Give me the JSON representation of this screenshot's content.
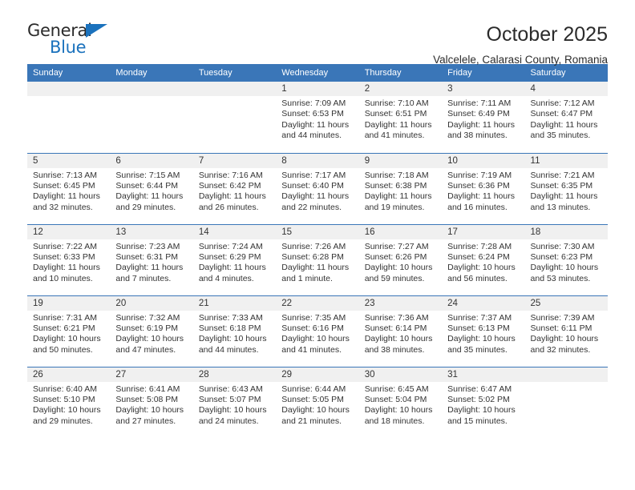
{
  "brand": {
    "name_top": "General",
    "name_bottom": "Blue"
  },
  "header": {
    "title": "October 2025",
    "subtitle": "Valcelele, Calarasi County, Romania"
  },
  "calendar": {
    "weekday_headers": [
      "Sunday",
      "Monday",
      "Tuesday",
      "Wednesday",
      "Thursday",
      "Friday",
      "Saturday"
    ],
    "accent_color": "#3a76b8",
    "daynum_band_color": "#f0f0f0",
    "text_color": "#333333",
    "weeks": [
      [
        {
          "day": "",
          "sunrise": "",
          "sunset": "",
          "daylight": ""
        },
        {
          "day": "",
          "sunrise": "",
          "sunset": "",
          "daylight": ""
        },
        {
          "day": "",
          "sunrise": "",
          "sunset": "",
          "daylight": ""
        },
        {
          "day": "1",
          "sunrise": "Sunrise: 7:09 AM",
          "sunset": "Sunset: 6:53 PM",
          "daylight": "Daylight: 11 hours and 44 minutes."
        },
        {
          "day": "2",
          "sunrise": "Sunrise: 7:10 AM",
          "sunset": "Sunset: 6:51 PM",
          "daylight": "Daylight: 11 hours and 41 minutes."
        },
        {
          "day": "3",
          "sunrise": "Sunrise: 7:11 AM",
          "sunset": "Sunset: 6:49 PM",
          "daylight": "Daylight: 11 hours and 38 minutes."
        },
        {
          "day": "4",
          "sunrise": "Sunrise: 7:12 AM",
          "sunset": "Sunset: 6:47 PM",
          "daylight": "Daylight: 11 hours and 35 minutes."
        }
      ],
      [
        {
          "day": "5",
          "sunrise": "Sunrise: 7:13 AM",
          "sunset": "Sunset: 6:45 PM",
          "daylight": "Daylight: 11 hours and 32 minutes."
        },
        {
          "day": "6",
          "sunrise": "Sunrise: 7:15 AM",
          "sunset": "Sunset: 6:44 PM",
          "daylight": "Daylight: 11 hours and 29 minutes."
        },
        {
          "day": "7",
          "sunrise": "Sunrise: 7:16 AM",
          "sunset": "Sunset: 6:42 PM",
          "daylight": "Daylight: 11 hours and 26 minutes."
        },
        {
          "day": "8",
          "sunrise": "Sunrise: 7:17 AM",
          "sunset": "Sunset: 6:40 PM",
          "daylight": "Daylight: 11 hours and 22 minutes."
        },
        {
          "day": "9",
          "sunrise": "Sunrise: 7:18 AM",
          "sunset": "Sunset: 6:38 PM",
          "daylight": "Daylight: 11 hours and 19 minutes."
        },
        {
          "day": "10",
          "sunrise": "Sunrise: 7:19 AM",
          "sunset": "Sunset: 6:36 PM",
          "daylight": "Daylight: 11 hours and 16 minutes."
        },
        {
          "day": "11",
          "sunrise": "Sunrise: 7:21 AM",
          "sunset": "Sunset: 6:35 PM",
          "daylight": "Daylight: 11 hours and 13 minutes."
        }
      ],
      [
        {
          "day": "12",
          "sunrise": "Sunrise: 7:22 AM",
          "sunset": "Sunset: 6:33 PM",
          "daylight": "Daylight: 11 hours and 10 minutes."
        },
        {
          "day": "13",
          "sunrise": "Sunrise: 7:23 AM",
          "sunset": "Sunset: 6:31 PM",
          "daylight": "Daylight: 11 hours and 7 minutes."
        },
        {
          "day": "14",
          "sunrise": "Sunrise: 7:24 AM",
          "sunset": "Sunset: 6:29 PM",
          "daylight": "Daylight: 11 hours and 4 minutes."
        },
        {
          "day": "15",
          "sunrise": "Sunrise: 7:26 AM",
          "sunset": "Sunset: 6:28 PM",
          "daylight": "Daylight: 11 hours and 1 minute."
        },
        {
          "day": "16",
          "sunrise": "Sunrise: 7:27 AM",
          "sunset": "Sunset: 6:26 PM",
          "daylight": "Daylight: 10 hours and 59 minutes."
        },
        {
          "day": "17",
          "sunrise": "Sunrise: 7:28 AM",
          "sunset": "Sunset: 6:24 PM",
          "daylight": "Daylight: 10 hours and 56 minutes."
        },
        {
          "day": "18",
          "sunrise": "Sunrise: 7:30 AM",
          "sunset": "Sunset: 6:23 PM",
          "daylight": "Daylight: 10 hours and 53 minutes."
        }
      ],
      [
        {
          "day": "19",
          "sunrise": "Sunrise: 7:31 AM",
          "sunset": "Sunset: 6:21 PM",
          "daylight": "Daylight: 10 hours and 50 minutes."
        },
        {
          "day": "20",
          "sunrise": "Sunrise: 7:32 AM",
          "sunset": "Sunset: 6:19 PM",
          "daylight": "Daylight: 10 hours and 47 minutes."
        },
        {
          "day": "21",
          "sunrise": "Sunrise: 7:33 AM",
          "sunset": "Sunset: 6:18 PM",
          "daylight": "Daylight: 10 hours and 44 minutes."
        },
        {
          "day": "22",
          "sunrise": "Sunrise: 7:35 AM",
          "sunset": "Sunset: 6:16 PM",
          "daylight": "Daylight: 10 hours and 41 minutes."
        },
        {
          "day": "23",
          "sunrise": "Sunrise: 7:36 AM",
          "sunset": "Sunset: 6:14 PM",
          "daylight": "Daylight: 10 hours and 38 minutes."
        },
        {
          "day": "24",
          "sunrise": "Sunrise: 7:37 AM",
          "sunset": "Sunset: 6:13 PM",
          "daylight": "Daylight: 10 hours and 35 minutes."
        },
        {
          "day": "25",
          "sunrise": "Sunrise: 7:39 AM",
          "sunset": "Sunset: 6:11 PM",
          "daylight": "Daylight: 10 hours and 32 minutes."
        }
      ],
      [
        {
          "day": "26",
          "sunrise": "Sunrise: 6:40 AM",
          "sunset": "Sunset: 5:10 PM",
          "daylight": "Daylight: 10 hours and 29 minutes."
        },
        {
          "day": "27",
          "sunrise": "Sunrise: 6:41 AM",
          "sunset": "Sunset: 5:08 PM",
          "daylight": "Daylight: 10 hours and 27 minutes."
        },
        {
          "day": "28",
          "sunrise": "Sunrise: 6:43 AM",
          "sunset": "Sunset: 5:07 PM",
          "daylight": "Daylight: 10 hours and 24 minutes."
        },
        {
          "day": "29",
          "sunrise": "Sunrise: 6:44 AM",
          "sunset": "Sunset: 5:05 PM",
          "daylight": "Daylight: 10 hours and 21 minutes."
        },
        {
          "day": "30",
          "sunrise": "Sunrise: 6:45 AM",
          "sunset": "Sunset: 5:04 PM",
          "daylight": "Daylight: 10 hours and 18 minutes."
        },
        {
          "day": "31",
          "sunrise": "Sunrise: 6:47 AM",
          "sunset": "Sunset: 5:02 PM",
          "daylight": "Daylight: 10 hours and 15 minutes."
        },
        {
          "day": "",
          "sunrise": "",
          "sunset": "",
          "daylight": ""
        }
      ]
    ]
  }
}
